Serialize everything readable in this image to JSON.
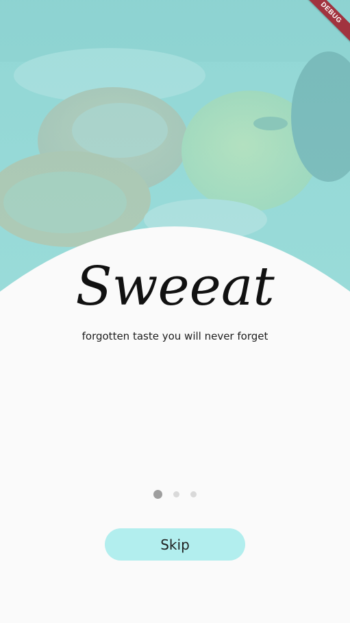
{
  "app": {
    "title": "Sweeat",
    "tagline": "forgotten taste you will never forget"
  },
  "debug_banner": {
    "label": "DEBUG"
  },
  "onboarding": {
    "page_count": 3,
    "active_page": 1
  },
  "actions": {
    "skip_label": "Skip"
  },
  "colors": {
    "hero_overlay": "#7fd3d3",
    "skip_button_bg": "#b2eeee",
    "background": "#fafafa",
    "dot_active": "#9e9e9e",
    "dot_inactive": "#d9d9d9",
    "debug_banner": "#a1333f"
  }
}
